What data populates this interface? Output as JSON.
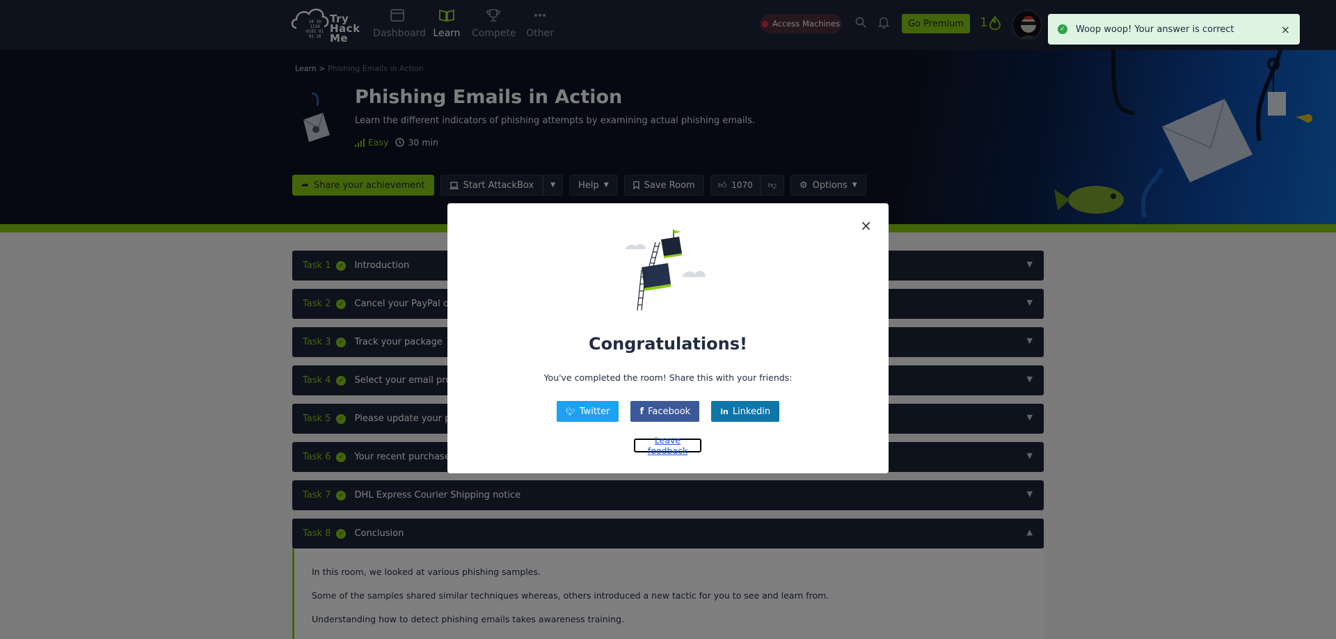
{
  "nav": {
    "logo": {
      "line1": "Try",
      "line2": "Hack",
      "line3": "Me"
    },
    "items": [
      {
        "label": "Dashboard",
        "icon": "dashboard-icon"
      },
      {
        "label": "Learn",
        "icon": "book-icon"
      },
      {
        "label": "Compete",
        "icon": "trophy-icon"
      },
      {
        "label": "Other",
        "icon": "more-icon"
      }
    ],
    "access_machines": "Access Machines",
    "go_premium": "Go Premium",
    "streak": "1"
  },
  "toast": {
    "message": "Woop woop! Your answer is correct",
    "close": "×"
  },
  "breadcrumb": {
    "root": "Learn",
    "separator": ">",
    "current": "Phishing Emails in Action"
  },
  "room": {
    "title": "Phishing Emails in Action",
    "description": "Learn the different indicators of phishing attempts by examining actual phishing emails.",
    "difficulty": "Easy",
    "duration": "30 min"
  },
  "actions": {
    "share": "Share your achievement",
    "attackbox": "Start AttackBox",
    "help": "Help",
    "save": "Save Room",
    "likes": "1070",
    "options": "Options"
  },
  "tasks": [
    {
      "num": "Task 1",
      "title": "Introduction"
    },
    {
      "num": "Task 2",
      "title": "Cancel your PayPal order"
    },
    {
      "num": "Task 3",
      "title": "Track your package"
    },
    {
      "num": "Task 4",
      "title": "Select your email provider to view document"
    },
    {
      "num": "Task 5",
      "title": "Please update your payment details"
    },
    {
      "num": "Task 6",
      "title": "Your recent purchase"
    },
    {
      "num": "Task 7",
      "title": "DHL Express Courier Shipping notice"
    },
    {
      "num": "Task 8",
      "title": "Conclusion"
    }
  ],
  "conclusion": {
    "p1": "In this room, we looked at various phishing samples.",
    "p2": "Some of the samples shared similar techniques whereas, others introduced a new tactic for you to see and learn from.",
    "p3": "Understanding how to detect phishing emails takes awareness training."
  },
  "modal": {
    "title": "Congratulations!",
    "subtitle": "You've completed the room! Share this with your friends:",
    "twitter": "Twitter",
    "facebook": "Facebook",
    "linkedin": "Linkedin",
    "feedback": "Leave feedback",
    "close": "×"
  },
  "colors": {
    "accent": "#88cc14",
    "navy": "#1c2538",
    "twitter": "#1da1f2",
    "facebook": "#3b5998",
    "linkedin": "#0e76a8"
  }
}
